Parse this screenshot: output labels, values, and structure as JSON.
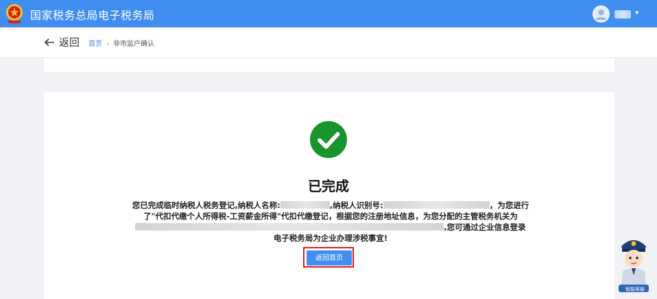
{
  "header": {
    "app_title": "国家税务总局电子税务局",
    "brand_color": "#3f8ef0",
    "logo_icon": "tax-emblem-icon",
    "user_icon": "user-avatar-icon",
    "user_name": "■■"
  },
  "nav": {
    "back_label": "返回",
    "breadcrumb": {
      "home": "首页",
      "separator": "›",
      "current": "非市监户确认"
    }
  },
  "result": {
    "status_icon": "check-circle-icon",
    "status_color": "#18952b",
    "title": "已完成",
    "msg_part1": "您已完成临时纳税人税务登记,纳税人名称:",
    "taxpayer_name_masked": "██████████",
    "msg_part2": ",纳税人识别号:",
    "taxpayer_id_masked": "██████████████████",
    "msg_part3": "，为您进行了\"代扣代缴个人所得税-工资薪金所得\"代扣代缴登记，根据您的注册地址信息，为您分配的主管税务机关为",
    "tax_office_masked": "█████████████████████████████████████",
    "msg_part4": ",您可通过企业信息登录电子税务局为企业办理涉税事宜!",
    "home_button_label": "返回首页",
    "highlight_color": "#e8151b"
  },
  "assistant": {
    "icon": "police-mascot-icon",
    "label": "智能客服"
  }
}
